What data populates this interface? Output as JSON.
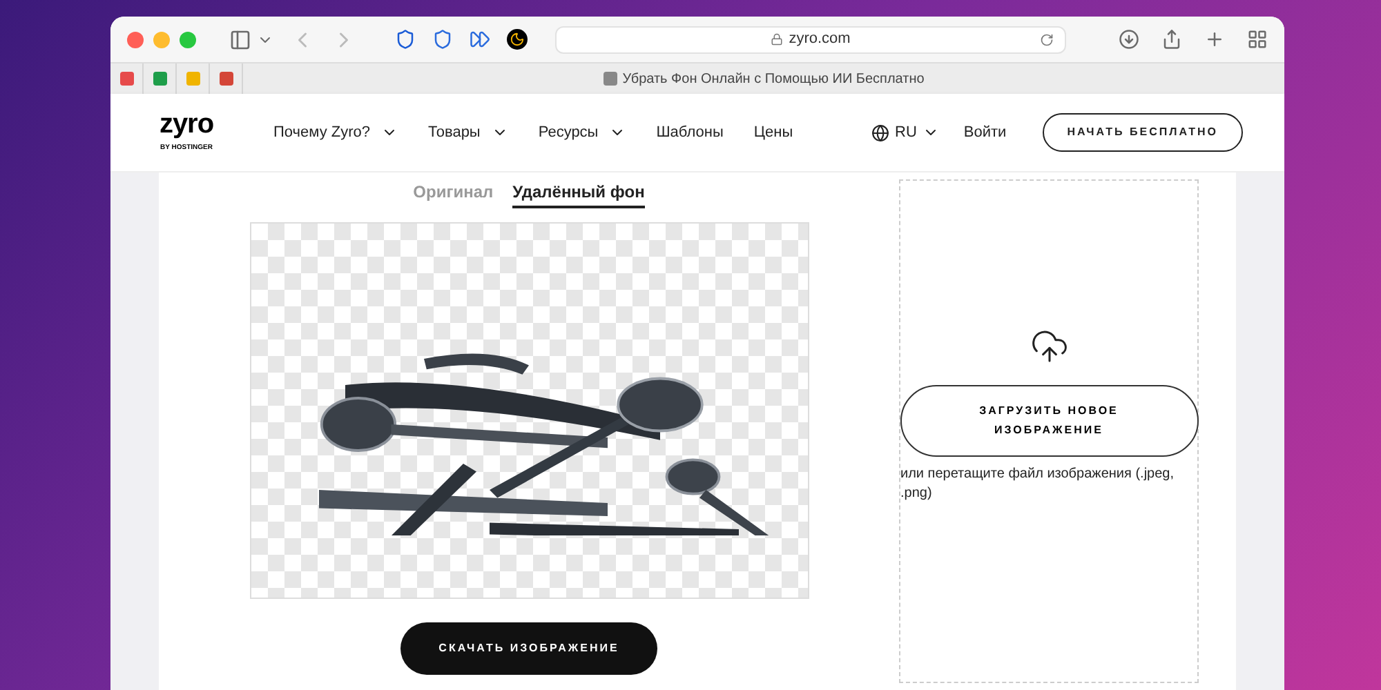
{
  "browser": {
    "address": "zyro.com",
    "tab_title": "Убрать Фон Онлайн с Помощью ИИ Бесплатно"
  },
  "header": {
    "logo": "zyro",
    "logo_sub": "BY HOSTINGER",
    "nav": [
      {
        "label": "Почему Zyro?",
        "has_menu": true
      },
      {
        "label": "Товары",
        "has_menu": true
      },
      {
        "label": "Ресурсы",
        "has_menu": true
      },
      {
        "label": "Шаблоны",
        "has_menu": false
      },
      {
        "label": "Цены",
        "has_menu": false
      }
    ],
    "language": "RU",
    "login": "Войти",
    "cta": "НАЧАТЬ БЕСПЛАТНО"
  },
  "view_tabs": [
    {
      "label": "Оригинал",
      "selected": false
    },
    {
      "label": "Удалённый фон",
      "selected": true
    }
  ],
  "download_button": "СКАЧАТЬ ИЗОБРАЖЕНИЕ",
  "upload": {
    "button": "ЗАГРУЗИТЬ НОВОЕ ИЗОБРАЖЕНИЕ",
    "hint": "или перетащите файл изображения (.jpeg, .png)"
  }
}
